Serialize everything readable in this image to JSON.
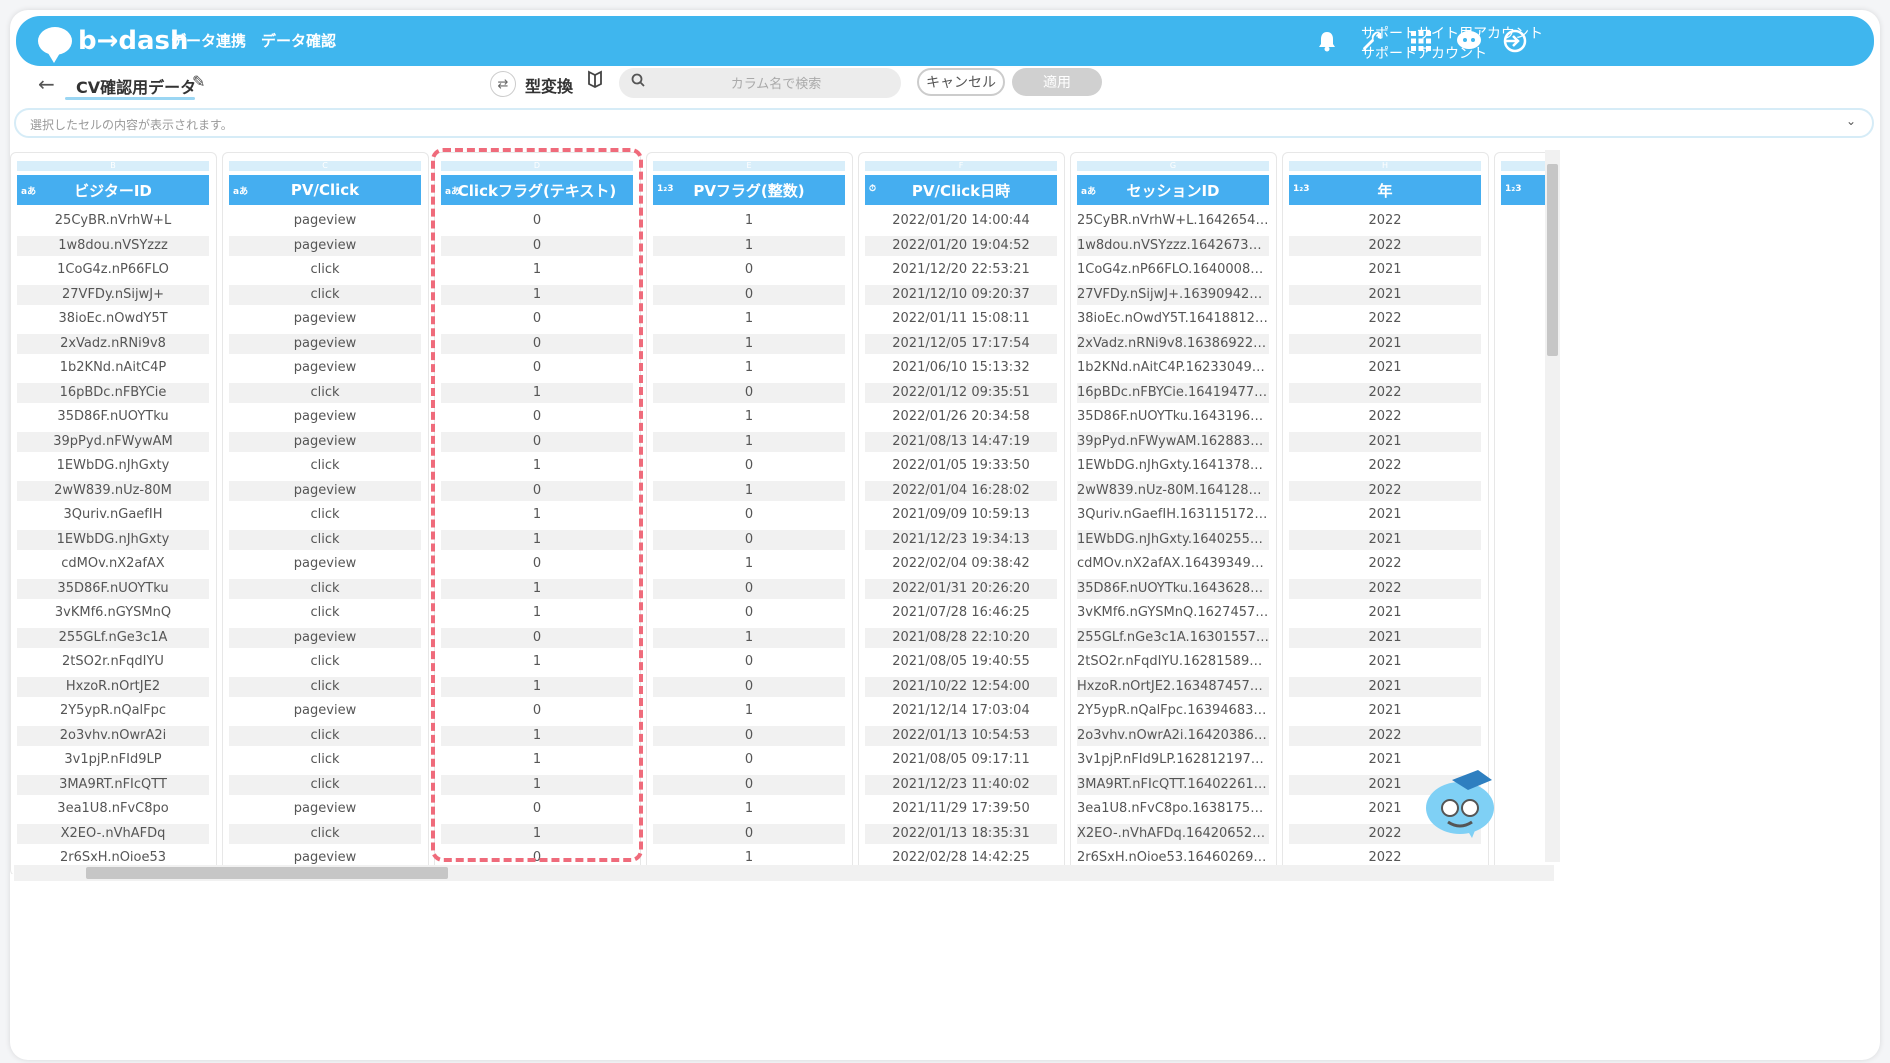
{
  "header": {
    "logo": "b→dash",
    "nav": [
      "データ連携",
      "データ確認"
    ],
    "account_line1": "サポートサイト用アカウント",
    "account_line2": "サポートアカウント",
    "icons": [
      "bell-icon",
      "wrench-icon",
      "grid-icon",
      "chat-bot-icon",
      "logout-icon"
    ]
  },
  "toolbar": {
    "back": "←",
    "dataset_name": "CV確認用データ",
    "type_convert_label": "型変換",
    "search_placeholder": "カラム名で検索",
    "cancel_label": "キャンセル",
    "apply_label": "適用"
  },
  "cellbar": {
    "placeholder": "選択したセルの内容が表示されます。"
  },
  "columns": [
    {
      "letter": "B",
      "type": "aあ",
      "name": "ビジターID"
    },
    {
      "letter": "C",
      "type": "aあ",
      "name": "PV/Click"
    },
    {
      "letter": "D",
      "type": "aあ",
      "name": "Clickフラグ(テキスト)"
    },
    {
      "letter": "E",
      "type": "1₂3",
      "name": "PVフラグ(整数)"
    },
    {
      "letter": "F",
      "type": "⏱",
      "name": "PV/Click日時"
    },
    {
      "letter": "G",
      "type": "aあ",
      "name": "セッションID"
    },
    {
      "letter": "H",
      "type": "1₂3",
      "name": "年"
    },
    {
      "letter": "I",
      "type": "1₂3",
      "name": ""
    }
  ],
  "rows": [
    [
      "25CyBR.nVrhW+L",
      "pageview",
      "0",
      "1",
      "2022/01/20 14:00:44",
      "25CyBR.nVrhW+L.16426547...",
      "2022"
    ],
    [
      "1w8dou.nVSYzzz",
      "pageview",
      "0",
      "1",
      "2022/01/20 19:04:52",
      "1w8dou.nVSYzzz.164267309...",
      "2022"
    ],
    [
      "1CoG4z.nP66FLO",
      "click",
      "1",
      "0",
      "2021/12/20 22:53:21",
      "1CoG4z.nP66FLO.16400081...",
      "2021"
    ],
    [
      "27VFDy.nSijwJ+",
      "click",
      "1",
      "0",
      "2021/12/10 09:20:37",
      "27VFDy.nSijwJ+.163909425...",
      "2021"
    ],
    [
      "38ioEc.nOwdY5T",
      "pageview",
      "0",
      "1",
      "2022/01/11 15:08:11",
      "38ioEc.nOwdY5T.164188121...",
      "2022"
    ],
    [
      "2xVadz.nRNi9v8",
      "pageview",
      "0",
      "1",
      "2021/12/05 17:17:54",
      "2xVadz.nRNi9v8.163869225...",
      "2021"
    ],
    [
      "1b2KNd.nAitC4P",
      "pageview",
      "0",
      "1",
      "2021/06/10 15:13:32",
      "1b2KNd.nAitC4P.162330495...",
      "2021"
    ],
    [
      "16pBDc.nFBYCie",
      "click",
      "1",
      "0",
      "2022/01/12 09:35:51",
      "16pBDc.nFBYCie.164194774...",
      "2022"
    ],
    [
      "35D86F.nUOYTku",
      "pageview",
      "0",
      "1",
      "2022/01/26 20:34:58",
      "35D86F.nUOYTku.16431966...",
      "2022"
    ],
    [
      "39pPyd.nFWywAM",
      "pageview",
      "0",
      "1",
      "2021/08/13 14:47:19",
      "39pPyd.nFWywAM.16288336...",
      "2021"
    ],
    [
      "1EWbDG.nJhGxty",
      "click",
      "1",
      "0",
      "2022/01/05 19:33:50",
      "1EWbDG.nJhGxty.16413785...",
      "2022"
    ],
    [
      "2wW839.nUz-80M",
      "pageview",
      "0",
      "1",
      "2022/01/04 16:28:02",
      "2wW839.nUz-80M.1641281...",
      "2022"
    ],
    [
      "3Quriv.nGaefIH",
      "click",
      "1",
      "0",
      "2021/09/09 10:59:13",
      "3Quriv.nGaefIH.1631151724...",
      "2021"
    ],
    [
      "1EWbDG.nJhGxty",
      "click",
      "1",
      "0",
      "2021/12/23 19:34:13",
      "1EWbDG.nJhGxty.16402554...",
      "2021"
    ],
    [
      "cdMOv.nX2afAX",
      "pageview",
      "0",
      "1",
      "2022/02/04 09:38:42",
      "cdMOv.nX2afAX.1643934972...",
      "2022"
    ],
    [
      "35D86F.nUOYTku",
      "click",
      "1",
      "0",
      "2022/01/31 20:26:20",
      "35D86F.nUOYTku.16436282...",
      "2022"
    ],
    [
      "3vKMf6.nGYSMnQ",
      "click",
      "1",
      "0",
      "2021/07/28 16:46:25",
      "3vKMf6.nGYSMnQ.16274575...",
      "2021"
    ],
    [
      "255GLf.nGe3c1A",
      "pageview",
      "0",
      "1",
      "2021/08/28 22:10:20",
      "255GLf.nGe3c1A.163015579...",
      "2021"
    ],
    [
      "2tSO2r.nFqdIYU",
      "click",
      "1",
      "0",
      "2021/08/05 19:40:55",
      "2tSO2r.nFqdIYU.162815894...",
      "2021"
    ],
    [
      "HxzoR.nOrtJE2",
      "click",
      "1",
      "0",
      "2021/10/22 12:54:00",
      "HxzoR.nOrtJE2.1634874573...",
      "2021"
    ],
    [
      "2Y5ypR.nQalFpc",
      "pageview",
      "0",
      "1",
      "2021/12/14 17:03:04",
      "2Y5ypR.nQalFpc.163946838...",
      "2021"
    ],
    [
      "2o3vhv.nOwrA2i",
      "click",
      "1",
      "0",
      "2022/01/13 10:54:53",
      "2o3vhv.nOwrA2i.164203869...",
      "2022"
    ],
    [
      "3v1pjP.nFId9LP",
      "click",
      "1",
      "0",
      "2021/08/05 09:17:11",
      "3v1pjP.nFId9LP.1628121972...",
      "2021"
    ],
    [
      "3MA9RT.nFIcQTT",
      "click",
      "1",
      "0",
      "2021/12/23 11:40:02",
      "3MA9RT.nFIcQTT.164022619...",
      "2021"
    ],
    [
      "3ea1U8.nFvC8po",
      "pageview",
      "0",
      "1",
      "2021/11/29 17:39:50",
      "3ea1U8.nFvC8po.163817518...",
      "2021"
    ],
    [
      "X2EO-.nVhAFDq",
      "click",
      "1",
      "0",
      "2022/01/13 18:35:31",
      "X2EO-.nVhAFDq.164206521...",
      "2022"
    ],
    [
      "2r6SxH.nOioe53",
      "pageview",
      "0",
      "1",
      "2022/02/28 14:42:25",
      "2r6SxH.nOioe53.164602694...",
      "2022"
    ]
  ],
  "colors": {
    "header": "#3fb6ee",
    "column_header": "#45aef0",
    "highlight": "#ef6b7b"
  }
}
